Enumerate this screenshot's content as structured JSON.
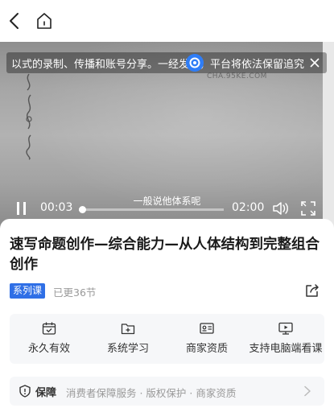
{
  "video": {
    "marquee_text": "以式的录制、传播和账号分享。一经发现，平台将依法保留追究",
    "watermark": "CHA.95KE.COM",
    "subtitle": "一般说他体系呢",
    "current_time": "00:03",
    "total_time": "02:00",
    "progress_fraction": 0.02
  },
  "course": {
    "title": "速写命题创作—综合能力—从人体结构到完整组合创作",
    "tag": "系列课",
    "update_status": "已更36节"
  },
  "features": [
    {
      "icon": "calendar-check-icon",
      "label": "永久有效"
    },
    {
      "icon": "folder-add-icon",
      "label": "系统学习"
    },
    {
      "icon": "id-card-icon",
      "label": "商家资质"
    },
    {
      "icon": "monitor-play-icon",
      "label": "支持电脑端看课"
    }
  ],
  "guarantee": {
    "label": "保障",
    "description": "消费者保障服务 · 版权保护 · 商家资质"
  },
  "colors": {
    "accent": "#2f6fe6",
    "panel_bg": "#f6f7f9",
    "muted_text": "#999999"
  }
}
